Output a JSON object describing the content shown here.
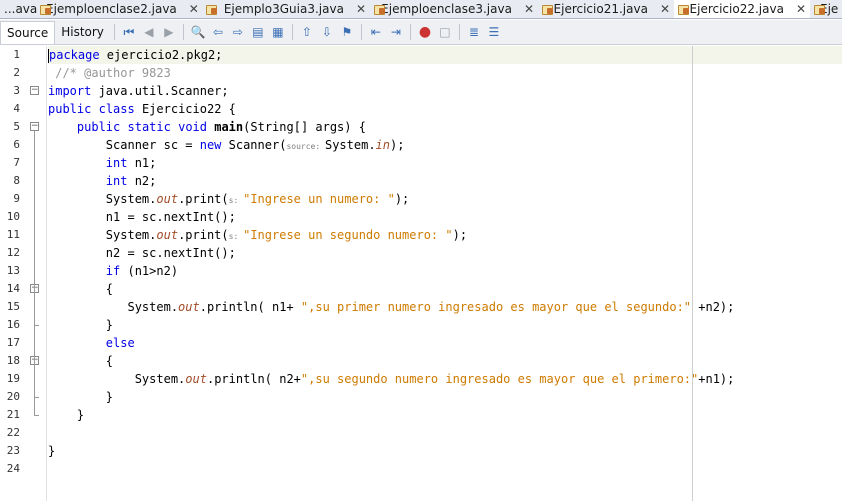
{
  "tabs": [
    {
      "label": "...ava",
      "active": false,
      "icon": false,
      "close": false
    },
    {
      "label": "Ejemploenclase2.java",
      "active": false,
      "icon": true,
      "close": true
    },
    {
      "label": "Ejemplo3Guia3.java",
      "active": false,
      "icon": true,
      "close": true
    },
    {
      "label": "Ejemploenclase3.java",
      "active": false,
      "icon": true,
      "close": true
    },
    {
      "label": "Ejercicio21.java",
      "active": false,
      "icon": true,
      "close": true
    },
    {
      "label": "Ejercicio22.java",
      "active": true,
      "icon": true,
      "close": true
    },
    {
      "label": "Eje",
      "active": false,
      "icon": true,
      "close": false
    }
  ],
  "close_glyph": "✕",
  "toolbar": {
    "source_label": "Source",
    "history_label": "History"
  },
  "editor": {
    "line_numbers": [
      "1",
      "2",
      "3",
      "4",
      "5",
      "6",
      "7",
      "8",
      "9",
      "10",
      "11",
      "12",
      "13",
      "14",
      "15",
      "16",
      "17",
      "18",
      "19",
      "20",
      "21",
      "22",
      "23",
      "24"
    ],
    "lines": [
      [
        {
          "t": "package",
          "c": "kw"
        },
        {
          "t": " ejercicio2.pkg2;"
        }
      ],
      [
        {
          "t": " //* @author 9823",
          "c": "cm"
        }
      ],
      [
        {
          "t": "import",
          "c": "kw"
        },
        {
          "t": " java.util.Scanner;"
        }
      ],
      [
        {
          "t": "public",
          "c": "kw"
        },
        {
          "t": " "
        },
        {
          "t": "class",
          "c": "kw"
        },
        {
          "t": " Ejercicio22 {"
        }
      ],
      [
        {
          "t": "    "
        },
        {
          "t": "public",
          "c": "kw"
        },
        {
          "t": " "
        },
        {
          "t": "static",
          "c": "kw"
        },
        {
          "t": " "
        },
        {
          "t": "void",
          "c": "kw"
        },
        {
          "t": " "
        },
        {
          "t": "main",
          "c": "bold"
        },
        {
          "t": "(String[] args) {"
        }
      ],
      [
        {
          "t": "        Scanner sc = "
        },
        {
          "t": "new",
          "c": "kw"
        },
        {
          "t": " Scanner("
        },
        {
          "t": "source: ",
          "c": "hint"
        },
        {
          "t": "System."
        },
        {
          "t": "in",
          "c": "fld"
        },
        {
          "t": ");"
        }
      ],
      [
        {
          "t": "        "
        },
        {
          "t": "int",
          "c": "kw"
        },
        {
          "t": " n1;"
        }
      ],
      [
        {
          "t": "        "
        },
        {
          "t": "int",
          "c": "kw"
        },
        {
          "t": " n2;"
        }
      ],
      [
        {
          "t": "        System."
        },
        {
          "t": "out",
          "c": "fld"
        },
        {
          "t": ".print("
        },
        {
          "t": "s: ",
          "c": "hint"
        },
        {
          "t": "\"Ingrese un numero: \"",
          "c": "str"
        },
        {
          "t": ");"
        }
      ],
      [
        {
          "t": "        n1 = sc.nextInt();"
        }
      ],
      [
        {
          "t": "        System."
        },
        {
          "t": "out",
          "c": "fld"
        },
        {
          "t": ".print("
        },
        {
          "t": "s: ",
          "c": "hint"
        },
        {
          "t": "\"Ingrese un segundo numero: \"",
          "c": "str"
        },
        {
          "t": ");"
        }
      ],
      [
        {
          "t": "        n2 = sc.nextInt();"
        }
      ],
      [
        {
          "t": "        "
        },
        {
          "t": "if",
          "c": "kw"
        },
        {
          "t": " (n1>n2)"
        }
      ],
      [
        {
          "t": "        {"
        }
      ],
      [
        {
          "t": "           System."
        },
        {
          "t": "out",
          "c": "fld"
        },
        {
          "t": ".println( n1+ "
        },
        {
          "t": "\",su primer numero ingresado es mayor que el segundo:\"",
          "c": "str"
        },
        {
          "t": " +n2);"
        }
      ],
      [
        {
          "t": "        }"
        }
      ],
      [
        {
          "t": "        "
        },
        {
          "t": "else",
          "c": "kw"
        }
      ],
      [
        {
          "t": "        {"
        }
      ],
      [
        {
          "t": "            System."
        },
        {
          "t": "out",
          "c": "fld"
        },
        {
          "t": ".println( n2+"
        },
        {
          "t": "\",su segundo numero ingresado es mayor que el primero:\"",
          "c": "str"
        },
        {
          "t": "+n1);"
        }
      ],
      [
        {
          "t": "        }"
        }
      ],
      [
        {
          "t": "    }"
        }
      ],
      [
        {
          "t": ""
        }
      ],
      [
        {
          "t": "}"
        }
      ],
      [
        {
          "t": ""
        }
      ]
    ],
    "fold_markers": {
      "3": "−",
      "5": "−",
      "14": "−",
      "18": "−"
    }
  },
  "colors": {
    "keyword": "#0000e6",
    "comment": "#969696",
    "string": "#ce7b00",
    "field": "#a34d2a",
    "current_line": "#f3f5ea"
  }
}
